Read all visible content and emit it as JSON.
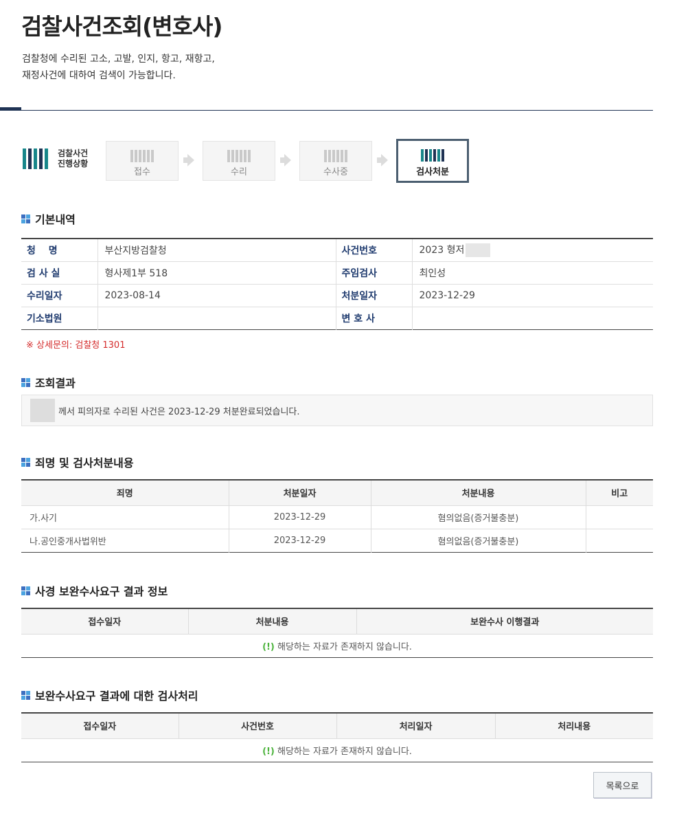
{
  "header": {
    "title": "검찰사건조회(변호사)",
    "desc_line1": "검찰청에 수리된 고소, 고발, 인지, 항고, 재항고,",
    "desc_line2": "재정사건에 대하여 검색이 가능합니다."
  },
  "progress": {
    "logo_line1": "검찰사건",
    "logo_line2": "진행상황",
    "steps": [
      {
        "label": "접수",
        "active": false
      },
      {
        "label": "수리",
        "active": false
      },
      {
        "label": "수사중",
        "active": false
      },
      {
        "label": "검사처분",
        "active": true
      }
    ]
  },
  "basic": {
    "section_title": "기본내역",
    "rows": [
      {
        "l1": "청　 명",
        "v1": "부산지방검찰청",
        "l2": "사건번호",
        "v2": "2023 형저"
      },
      {
        "l1": "검 사 실",
        "v1": "형사제1부 518",
        "l2": "주임검사",
        "v2": "최인성"
      },
      {
        "l1": "수리일자",
        "v1": "2023-08-14",
        "l2": "처분일자",
        "v2": "2023-12-29"
      },
      {
        "l1": "기소법원",
        "v1": "",
        "l2": "변 호 사",
        "v2": ""
      }
    ],
    "notice": "※ 상세문의: 검찰청 1301"
  },
  "result": {
    "section_title": "조회결과",
    "text": "께서 피의자로 수리된 사건은 2023-12-29 처분완료되었습니다."
  },
  "charges": {
    "section_title": "죄명 및 검사처분내용",
    "headers": [
      "죄명",
      "처분일자",
      "처분내용",
      "비고"
    ],
    "rows": [
      [
        "가.사기",
        "2023-12-29",
        "혐의없음(증거불충분)",
        ""
      ],
      [
        "나.공인중개사법위반",
        "2023-12-29",
        "혐의없음(증거불충분)",
        ""
      ]
    ]
  },
  "supplement": {
    "section_title": "사경 보완수사요구 결과 정보",
    "headers": [
      "접수일자",
      "처분내용",
      "보완수사 이행결과"
    ],
    "empty_mark": "(!)",
    "empty_text": " 해당하는 자료가 존재하지 않습니다."
  },
  "prosecutor_processing": {
    "section_title": "보완수사요구 결과에 대한 검사처리",
    "headers": [
      "접수일자",
      "사건번호",
      "처리일자",
      "처리내용"
    ],
    "empty_mark": "(!)",
    "empty_text": " 해당하는 자료가 존재하지 않습니다."
  },
  "buttons": {
    "list": "목록으로"
  }
}
